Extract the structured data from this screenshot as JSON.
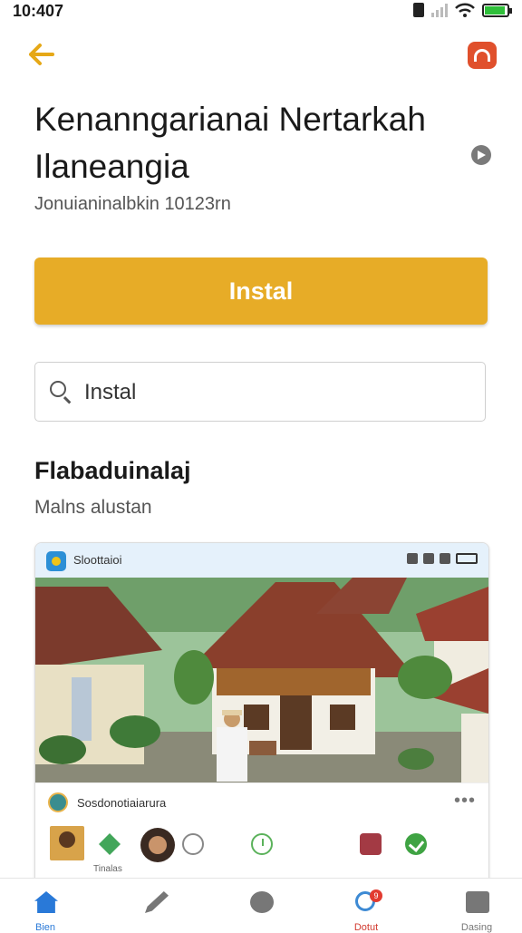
{
  "status_bar": {
    "time": "10:407"
  },
  "header": {
    "back_icon": "arrow-left-icon",
    "action_icon": "app-badge-icon"
  },
  "app": {
    "title": "Kenanngarianai Nertarkah Ilaneangia",
    "subtitle": "Jonuianinalbkin 10123rn",
    "install_label": "Instal"
  },
  "search": {
    "value": "Instal",
    "placeholder": "Instal"
  },
  "section": {
    "title": "Flabaduinalaj",
    "subtitle": "Malns alustan"
  },
  "card": {
    "bar_name": "Sloottaioi",
    "meta_label": "Sosdonotiaiarura",
    "more_icon": "more-horizontal-icon",
    "caption": "Tinalas"
  },
  "bottom_nav": {
    "items": [
      {
        "label": "Bien",
        "icon": "home-icon"
      },
      {
        "label": "",
        "icon": "pen-icon"
      },
      {
        "label": "",
        "icon": "circle-icon"
      },
      {
        "label": "Dotut",
        "icon": "search-icon",
        "badge": "9"
      },
      {
        "label": "Dasing",
        "icon": "profile-icon"
      }
    ]
  },
  "colors": {
    "accent": "#e7ac27",
    "link_blue": "#2979d8",
    "header_icon": "#e0502c"
  }
}
